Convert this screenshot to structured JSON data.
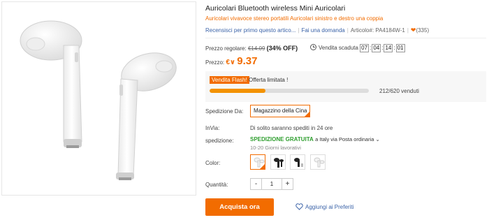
{
  "product": {
    "title": "Auricolari Bluetooth wireless Mini Auricolari",
    "subtitle": "Auricolari vivavoce stereo portatili Auricolari sinistro e destro una coppia",
    "review_link": "Recensisci per primo questo artico...",
    "question_link": "Fai una domanda",
    "article_label": "Articolo#:",
    "article_code": "PA4184W-1",
    "likes": "(335)"
  },
  "pricing": {
    "regular_label": "Prezzo regolare:",
    "regular_value": "€14.09",
    "discount": "(34% OFF)",
    "expiry_label": "Vendita scaduta",
    "timer": [
      "07",
      "04",
      "14",
      "01"
    ],
    "price_label": "Prezzo:",
    "currency": "€∨",
    "price": "9.37"
  },
  "flash_sale": {
    "badge": "Vendita Flash!",
    "offer_text": "Offerta limitata !",
    "progress_fraction": 0.35,
    "sold_text": "212/620 venduti"
  },
  "shipping": {
    "from_label": "Spedizione Da:",
    "warehouse": "Magazzino della Cina",
    "dispatch_label": "InVia:",
    "dispatch_text": "Di solito saranno spediti in 24 ore",
    "shipping_label": "spedizione:",
    "free_text": "SPEDIZIONE GRATUITA",
    "dest_prefix": "a",
    "dest_text": "Italy via Posta ordinaria",
    "days_text": "10-20 Giorni lavorativi"
  },
  "options": {
    "color_label": "Color:",
    "quantity_label": "Quantità:",
    "qty_minus": "-",
    "qty_value": "1",
    "qty_plus": "+"
  },
  "actions": {
    "buy_label": "Acquista ora",
    "wishlist_label": "Aggiungi ai Preferiti"
  },
  "colors": {
    "accent": "#f26c00",
    "link": "#3b63a8",
    "free_shipping": "#2e9e2e"
  }
}
